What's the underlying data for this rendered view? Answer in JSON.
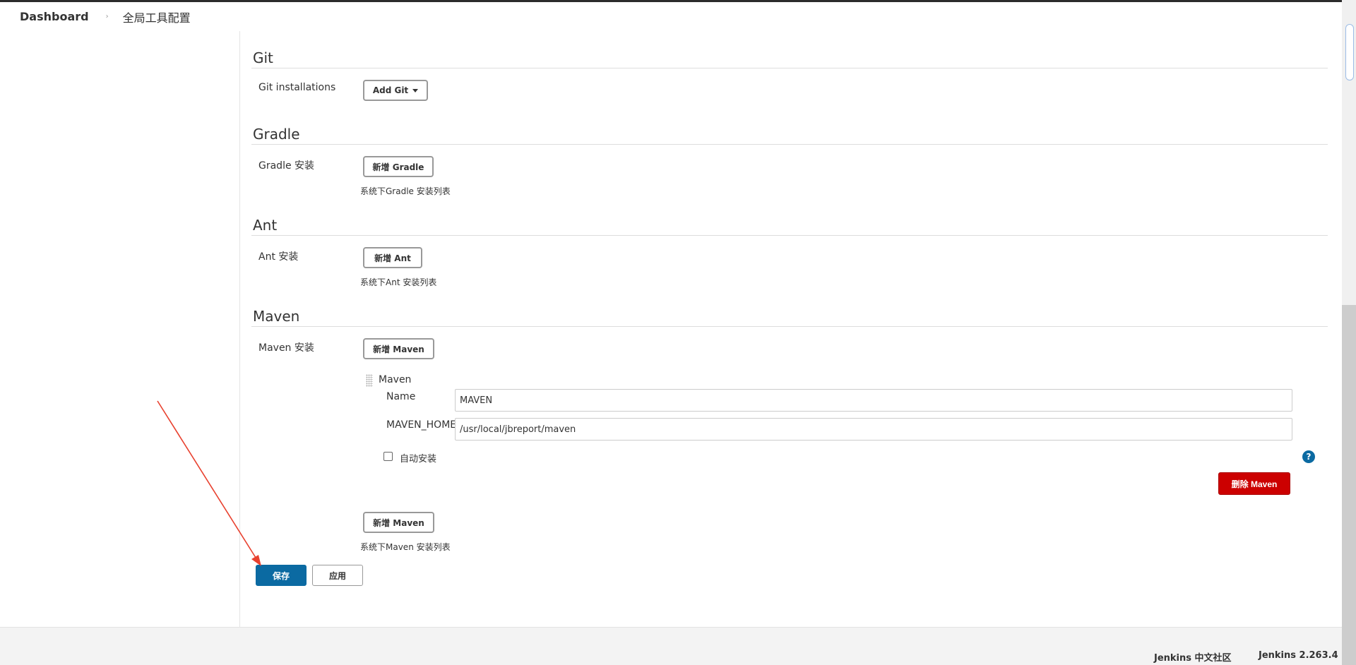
{
  "breadcrumb": {
    "home": "Dashboard",
    "separator": "›",
    "current": "全局工具配置"
  },
  "git": {
    "title": "Git",
    "label": "Git installations",
    "add_button": "Add Git"
  },
  "gradle": {
    "title": "Gradle",
    "label": "Gradle 安装",
    "add_button": "新增 Gradle",
    "help": "系统下Gradle 安装列表"
  },
  "ant": {
    "title": "Ant",
    "label": "Ant 安装",
    "add_button": "新增 Ant",
    "help": "系统下Ant 安装列表"
  },
  "maven": {
    "title": "Maven",
    "label": "Maven 安装",
    "add_button": "新增 Maven",
    "item_title": "Maven",
    "name_label": "Name",
    "name_value": "MAVEN",
    "home_label": "MAVEN_HOME",
    "home_value": "/usr/local/jbreport/maven",
    "auto_install_label": "自动安装",
    "auto_install_checked": false,
    "help_icon": "?",
    "delete_button": "删除 Maven",
    "add_button_bottom": "新增 Maven",
    "help": "系统下Maven 安装列表"
  },
  "actions": {
    "save": "保存",
    "apply": "应用"
  },
  "footer": {
    "community": "Jenkins 中文社区",
    "version": "Jenkins 2.263.4"
  },
  "colors": {
    "primary": "#0b6aa2",
    "danger": "#cc0000",
    "annotation_arrow": "#e8412f"
  }
}
